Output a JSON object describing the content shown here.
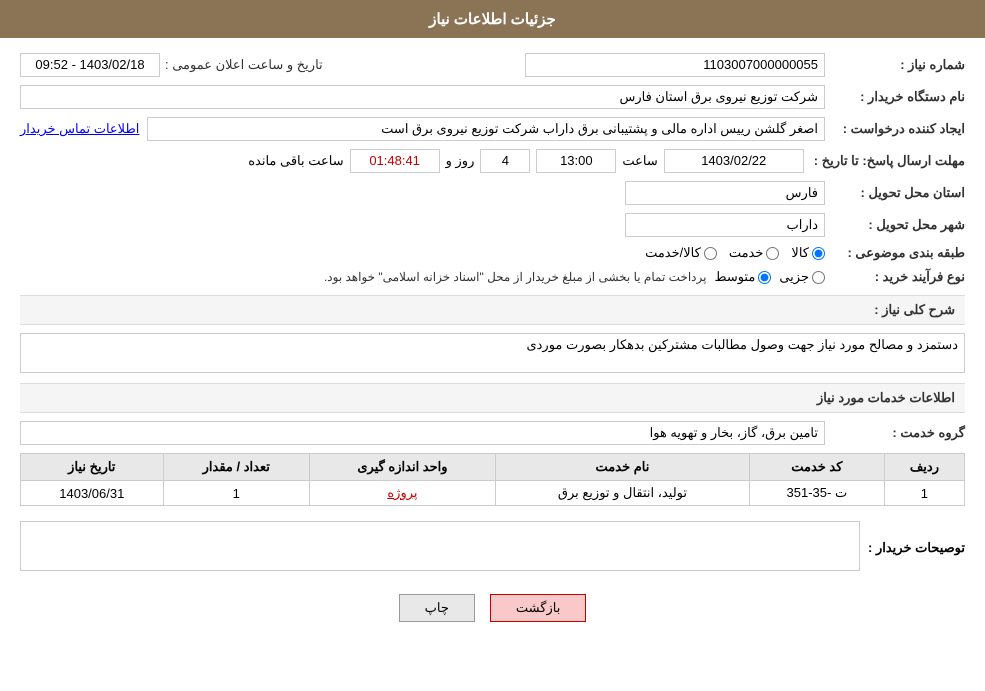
{
  "header": {
    "title": "جزئیات اطلاعات نیاز"
  },
  "fields": {
    "need_number_label": "شماره نیاز :",
    "need_number_value": "1103007000000055",
    "buyer_org_label": "نام دستگاه خریدار :",
    "buyer_org_value": "شرکت توزیع نیروی برق استان فارس",
    "creator_label": "ایجاد کننده درخواست :",
    "creator_value": "اصغر گلشن رییس اداره مالی و پشتیبانی برق داراب شرکت توزیع نیروی برق است",
    "contact_info_label": "اطلاعات تماس خریدار",
    "response_deadline_label": "مهلت ارسال پاسخ: تا تاریخ :",
    "announce_label": "تاریخ و ساعت اعلان عمومی :",
    "announce_value": "1403/02/18 - 09:52",
    "deadline_date": "1403/02/22",
    "deadline_time": "13:00",
    "deadline_days": "4",
    "deadline_countdown": "01:48:41",
    "deadline_days_label": "روز و",
    "deadline_hours_label": "ساعت باقی مانده",
    "delivery_province_label": "استان محل تحویل :",
    "delivery_province_value": "فارس",
    "delivery_city_label": "شهر محل تحویل :",
    "delivery_city_value": "داراب",
    "category_label": "طبقه بندی موضوعی :",
    "category_options": [
      "کالا",
      "خدمت",
      "کالا/خدمت"
    ],
    "category_selected": "کالا",
    "purchase_type_label": "نوع فرآیند خرید :",
    "purchase_options": [
      "جزیی",
      "متوسط"
    ],
    "purchase_note": "پرداخت تمام یا بخشی از مبلغ خریدار از محل \"اسناد خزانه اسلامی\" خواهد بود.",
    "need_description_label": "شرح کلی نیاز :",
    "need_description_value": "دستمزد و مصالح مورد نیاز جهت وصول مطالبات مشترکین بدهکار بصورت موردی",
    "services_section_label": "اطلاعات خدمات مورد نیاز",
    "service_group_label": "گروه خدمت :",
    "service_group_value": "تامین برق، گاز، بخار و تهویه هوا",
    "table_headers": [
      "ردیف",
      "کد خدمت",
      "نام خدمت",
      "واحد اندازه گیری",
      "تعداد / مقدار",
      "تاریخ نیاز"
    ],
    "table_rows": [
      {
        "row": "1",
        "service_code": "ت -35-351",
        "service_name": "تولید، انتقال و توزیع برق",
        "unit": "پروژه",
        "quantity": "1",
        "date": "1403/06/31"
      }
    ],
    "buyer_description_label": "توصیحات خریدار :",
    "buyer_description_value": ""
  },
  "buttons": {
    "back_label": "بازگشت",
    "print_label": "چاپ"
  }
}
